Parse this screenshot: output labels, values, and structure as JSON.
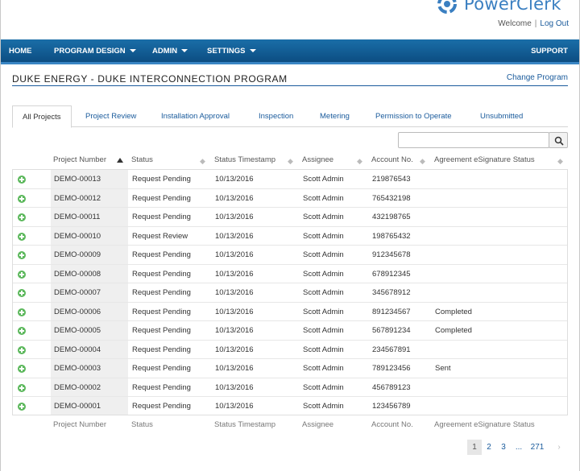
{
  "brand": {
    "name": "PowerClerk",
    "accent": "#3a7fc1"
  },
  "header": {
    "welcome": "Welcome",
    "separator": "|",
    "logout": "Log Out"
  },
  "nav": {
    "items": [
      {
        "label": "HOME",
        "dropdown": false
      },
      {
        "label": "PROGRAM DESIGN",
        "dropdown": true
      },
      {
        "label": "ADMIN",
        "dropdown": true
      },
      {
        "label": "SETTINGS",
        "dropdown": true
      }
    ],
    "support": "SUPPORT",
    "color": "#0c4d82"
  },
  "program": {
    "title": "DUKE ENERGY - DUKE INTERCONNECTION PROGRAM",
    "change_link": "Change Program"
  },
  "tabs": [
    "All Projects",
    "Project Review",
    "Installation Approval",
    "Inspection",
    "Metering",
    "Permission to Operate",
    "Unsubmitted"
  ],
  "active_tab": "All Projects",
  "search": {
    "placeholder": "",
    "icon": "search-icon"
  },
  "table": {
    "columns": [
      "Project Number",
      "Status",
      "Status Timestamp",
      "Assignee",
      "Account No.",
      "Agreement eSignature Status"
    ],
    "sort_column": "Project Number",
    "sort_direction": "ascending",
    "rows": [
      [
        "DEMO-00013",
        "Request Pending",
        "10/13/2016",
        "Scott Admin",
        "219876543",
        ""
      ],
      [
        "DEMO-00012",
        "Request Pending",
        "10/13/2016",
        "Scott Admin",
        "765432198",
        ""
      ],
      [
        "DEMO-00011",
        "Request Pending",
        "10/13/2016",
        "Scott Admin",
        "432198765",
        ""
      ],
      [
        "DEMO-00010",
        "Request Review",
        "10/13/2016",
        "Scott Admin",
        "198765432",
        ""
      ],
      [
        "DEMO-00009",
        "Request Pending",
        "10/13/2016",
        "Scott Admin",
        "912345678",
        ""
      ],
      [
        "DEMO-00008",
        "Request Pending",
        "10/13/2016",
        "Scott Admin",
        "678912345",
        ""
      ],
      [
        "DEMO-00007",
        "Request Pending",
        "10/13/2016",
        "Scott Admin",
        "345678912",
        ""
      ],
      [
        "DEMO-00006",
        "Request Pending",
        "10/13/2016",
        "Scott Admin",
        "891234567",
        "Completed"
      ],
      [
        "DEMO-00005",
        "Request Pending",
        "10/13/2016",
        "Scott Admin",
        "567891234",
        "Completed"
      ],
      [
        "DEMO-00004",
        "Request Pending",
        "10/13/2016",
        "Scott Admin",
        "234567891",
        ""
      ],
      [
        "DEMO-00003",
        "Request Pending",
        "10/13/2016",
        "Scott Admin",
        "789123456",
        "Sent"
      ],
      [
        "DEMO-00002",
        "Request Pending",
        "10/13/2016",
        "Scott Admin",
        "456789123",
        ""
      ],
      [
        "DEMO-00001",
        "Request Pending",
        "10/13/2016",
        "Scott Admin",
        "123456789",
        ""
      ]
    ]
  },
  "pagination": {
    "pages": [
      "1",
      "2",
      "3",
      "...",
      "271"
    ],
    "current": "1",
    "next_icon": "chevron-right-icon"
  }
}
